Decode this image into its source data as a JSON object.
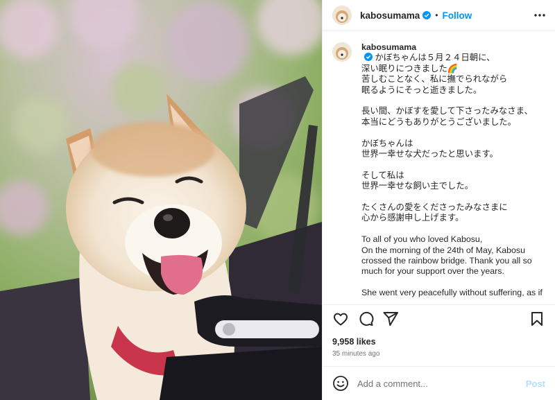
{
  "header": {
    "username": "kabosumama",
    "separator": "•",
    "follow_label": "Follow"
  },
  "caption": {
    "username": "kabosumama",
    "paragraphs": [
      "かぼちゃんは５月２４日朝に、\n深い眠りにつきました🌈\n苦しむことなく、私に撫でられながら\n眠るようにそっと逝きました。",
      "長い間、かぼすを愛して下さったみなさま、\n本当にどうもありがとうございました。",
      "かぼちゃんは\n世界一幸せな犬だったと思います。",
      "そして私は\n世界一幸せな飼い主でした。",
      "たくさんの愛をくださったみなさまに\n心から感謝申し上げます。",
      "To all of you who loved Kabosu,\nOn the morning of the 24th of May, Kabosu crossed the rainbow bridge. Thank you all so much for your support over the years.",
      "She went very peacefully without suffering, as if falling asleep while feeling the warmth of my hands petting her."
    ]
  },
  "stats": {
    "likes": "9,958 likes",
    "time_ago": "35 minutes ago"
  },
  "comment_box": {
    "placeholder": "Add a comment...",
    "post_label": "Post"
  },
  "colors": {
    "accent": "#0095f6",
    "verified": "#0095f6",
    "post_disabled": "#b2dffc",
    "muted": "#737373"
  },
  "icons": {
    "header_more": "more-horizontal-icon",
    "like": "heart-icon",
    "comment": "comment-bubble-icon",
    "share": "send-paper-plane-icon",
    "save": "bookmark-icon",
    "emoji": "emoji-smiley-icon",
    "verified": "verified-badge-icon"
  }
}
